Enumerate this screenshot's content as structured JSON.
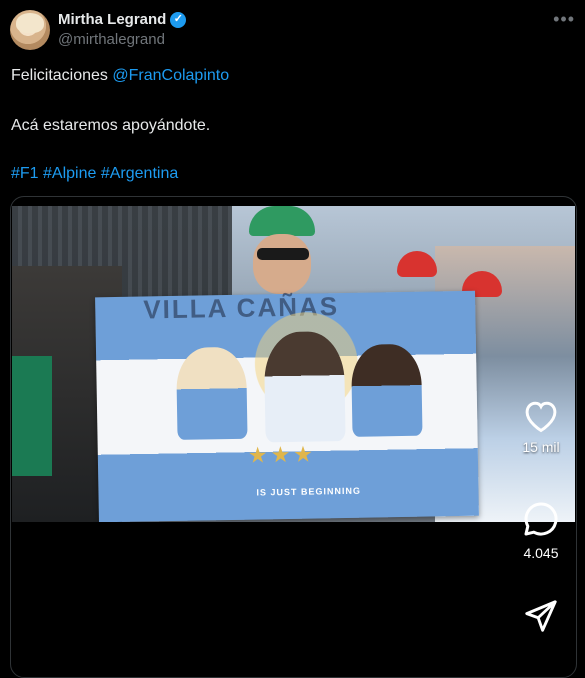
{
  "author": {
    "name": "Mirtha Legrand",
    "handle": "@mirthalegrand",
    "verified_symbol": "✓"
  },
  "more_label": "•••",
  "tweet": {
    "line1_prefix": "Felicitaciones ",
    "mention": "@FranColapinto",
    "line2": "Acá estaremos apoyándote.",
    "hashtags": [
      "#F1",
      "#Alpine",
      "#Argentina"
    ]
  },
  "media": {
    "flag_top_text": "VILLA CAÑAS",
    "stars": "★★★",
    "flag_caption": "IS JUST BEGINNING"
  },
  "actions": {
    "likes": "15 mil",
    "replies": "4.045"
  },
  "colors": {
    "accent": "#1d9bf0",
    "background": "#000000",
    "text": "#e7e9ea",
    "muted": "#71767b"
  }
}
